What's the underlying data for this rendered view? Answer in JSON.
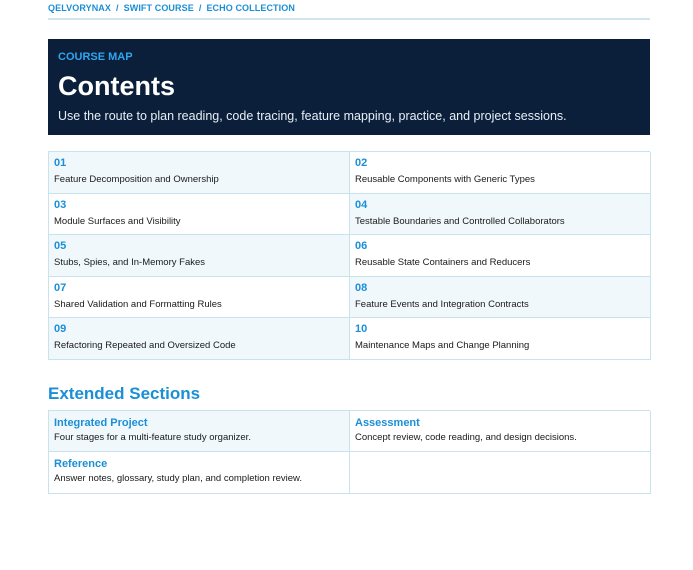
{
  "breadcrumb": {
    "items": [
      "QELVORYNAX",
      "SWIFT COURSE",
      "ECHO COLLECTION"
    ],
    "separator": "/"
  },
  "hero": {
    "eyebrow": "COURSE MAP",
    "title": "Contents",
    "subtitle": "Use the route to plan reading, code tracing, feature mapping, practice, and project sessions."
  },
  "contents": [
    {
      "number": "01",
      "label": "Feature Decomposition and Ownership"
    },
    {
      "number": "02",
      "label": "Reusable Components with Generic Types"
    },
    {
      "number": "03",
      "label": "Module Surfaces and Visibility"
    },
    {
      "number": "04",
      "label": "Testable Boundaries and Controlled Collaborators"
    },
    {
      "number": "05",
      "label": "Stubs, Spies, and In-Memory Fakes"
    },
    {
      "number": "06",
      "label": "Reusable State Containers and Reducers"
    },
    {
      "number": "07",
      "label": "Shared Validation and Formatting Rules"
    },
    {
      "number": "08",
      "label": "Feature Events and Integration Contracts"
    },
    {
      "number": "09",
      "label": "Refactoring Repeated and Oversized Code"
    },
    {
      "number": "10",
      "label": "Maintenance Maps and Change Planning"
    }
  ],
  "extended": {
    "heading": "Extended Sections",
    "items": [
      {
        "title": "Integrated Project",
        "description": "Four stages for a multi-feature study organizer."
      },
      {
        "title": "Assessment",
        "description": "Concept review, code reading, and design decisions."
      },
      {
        "title": "Reference",
        "description": "Answer notes, glossary, study plan, and completion review."
      }
    ]
  },
  "colors": {
    "accent": "#1a8fd6",
    "hero_background": "#0b1f3a",
    "cell_shade": "#f1f8fc",
    "border": "#c8e2ee"
  }
}
